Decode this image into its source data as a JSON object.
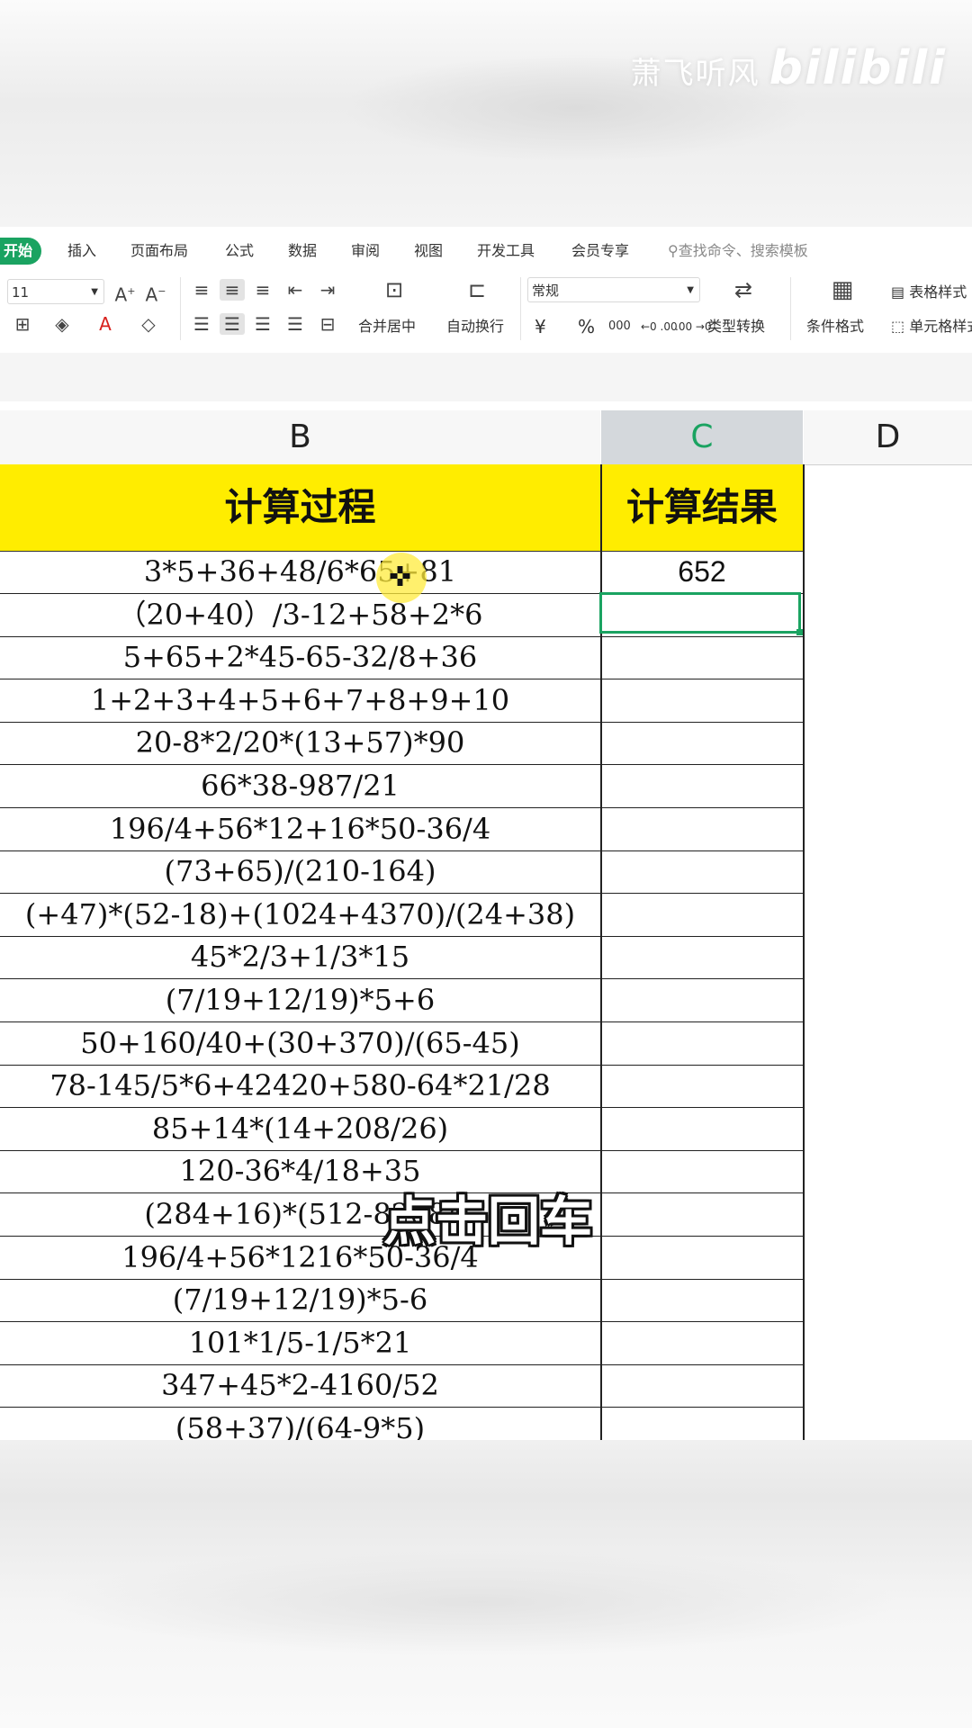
{
  "watermark": {
    "text": "萧飞听风",
    "brand": "bilibili"
  },
  "ribbon": {
    "tabs": [
      "开始",
      "插入",
      "页面布局",
      "公式",
      "数据",
      "审阅",
      "视图",
      "开发工具",
      "会员专享"
    ],
    "search_placeholder": "查找命令、搜索模板",
    "font_size": "11",
    "number_format": "常规",
    "merge_label": "合并居中",
    "wrap_label": "自动换行",
    "type_convert_label": "类型转换",
    "cond_format_label": "条件格式",
    "table_style_label": "表格样式",
    "cell_style_label": "单元格样式",
    "percent": "%",
    "currency": "¥",
    "thousands": "000",
    "inc_dec": "←0 .00",
    "dec_dec": ".00 →0"
  },
  "sheet": {
    "columns": {
      "b": "B",
      "c": "C",
      "d": "D"
    },
    "headers": {
      "b": "计算过程",
      "c": "计算结果"
    },
    "rows": [
      {
        "b": "3*5+36+48/6*65+81",
        "c": "652"
      },
      {
        "b": "（20+40）/3-12+58+2*6",
        "c": ""
      },
      {
        "b": "5+65+2*45-65-32/8+36",
        "c": ""
      },
      {
        "b": "1+2+3+4+5+6+7+8+9+10",
        "c": ""
      },
      {
        "b": "20-8*2/20*(13+57)*90",
        "c": ""
      },
      {
        "b": "66*38-987/21",
        "c": ""
      },
      {
        "b": "196/4+56*12+16*50-36/4",
        "c": ""
      },
      {
        "b": "(73+65)/(210-164)",
        "c": ""
      },
      {
        "b": "(+47)*(52-18)+(1024+4370)/(24+38)",
        "c": ""
      },
      {
        "b": "45*2/3+1/3*15",
        "c": ""
      },
      {
        "b": "(7/19+12/19)*5+6",
        "c": ""
      },
      {
        "b": "50+160/40+(30+370)/(65-45)",
        "c": ""
      },
      {
        "b": "78-145/5*6+42420+580-64*21/28",
        "c": ""
      },
      {
        "b": "85+14*(14+208/26)",
        "c": ""
      },
      {
        "b": "120-36*4/18+35",
        "c": ""
      },
      {
        "b": "(284+16)*(512-8208/",
        "c": ""
      },
      {
        "b": "196/4+56*1216*50-36/4",
        "c": ""
      },
      {
        "b": "(7/19+12/19)*5-6",
        "c": ""
      },
      {
        "b": "101*1/5-1/5*21",
        "c": ""
      },
      {
        "b": "347+45*2-4160/52",
        "c": ""
      },
      {
        "b": "(58+37)/(64-9*5)",
        "c": ""
      }
    ]
  },
  "subtitle": "点击回车"
}
